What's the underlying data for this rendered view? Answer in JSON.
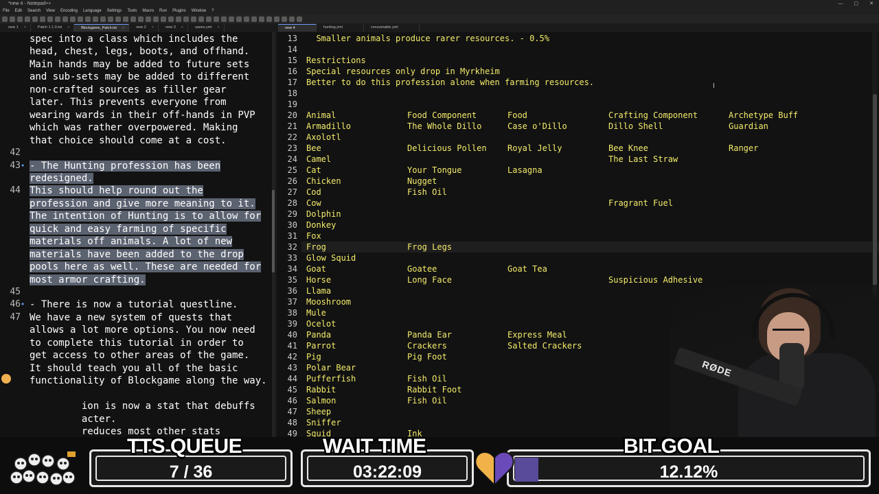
{
  "app": {
    "title": "*new 4 - Notepad++",
    "menu": [
      "File",
      "Edit",
      "Search",
      "View",
      "Encoding",
      "Language",
      "Settings",
      "Tools",
      "Macro",
      "Run",
      "Plugins",
      "Window",
      "?"
    ],
    "window_controls": [
      "—",
      "▢",
      "✕"
    ]
  },
  "left_tabs": [
    "new 1",
    "Patch 1.1.0.txt",
    "Blockgame_Patch.txt",
    "new 2",
    "new 3",
    "saves.yml"
  ],
  "right_tabs": [
    "new 4",
    "hunting.yml",
    "consumable.yml"
  ],
  "left_editor": {
    "lines": [
      {
        "num": "",
        "text": "spec into a class which includes the",
        "hl": false
      },
      {
        "num": "",
        "text": "head, chest, legs, boots, and offhand.",
        "hl": false
      },
      {
        "num": "",
        "text": "Main hands may be added to future sets",
        "hl": false
      },
      {
        "num": "",
        "text": "and sub-sets may be added to different",
        "hl": false
      },
      {
        "num": "",
        "text": "non-crafted sources as filler gear",
        "hl": false
      },
      {
        "num": "",
        "text": "later. This prevents everyone from",
        "hl": false
      },
      {
        "num": "",
        "text": "wearing wards in their off-hands in PVP",
        "hl": false
      },
      {
        "num": "",
        "text": "which was rather overpowered. Making",
        "hl": false
      },
      {
        "num": "",
        "text": "that choice should come at a cost.",
        "hl": false
      },
      {
        "num": "42",
        "text": "",
        "hl": false
      },
      {
        "num": "43",
        "text": "- The Hunting profession has been",
        "hl": true
      },
      {
        "num": "",
        "text": "redesigned.",
        "hl": true
      },
      {
        "num": "44",
        "text": "This should help round out the",
        "hl": true
      },
      {
        "num": "",
        "text": "profession and give more meaning to it.",
        "hl": true
      },
      {
        "num": "",
        "text": "The intention of Hunting is to allow for",
        "hl": true
      },
      {
        "num": "",
        "text": "quick and easy farming of specific",
        "hl": true
      },
      {
        "num": "",
        "text": "materials off animals. A lot of new",
        "hl": true
      },
      {
        "num": "",
        "text": "materials have been added to the drop",
        "hl": true
      },
      {
        "num": "",
        "text": "pools here as well. These are needed for",
        "hl": true
      },
      {
        "num": "",
        "text": "most armor crafting.",
        "hl": true
      },
      {
        "num": "45",
        "text": "",
        "hl": false
      },
      {
        "num": "46",
        "text": "- There is now a tutorial questline.",
        "hl": false
      },
      {
        "num": "47",
        "text": "We have a new system of quests that",
        "hl": false
      },
      {
        "num": "",
        "text": "allows a lot more options. You now need",
        "hl": false
      },
      {
        "num": "",
        "text": "to complete this tutorial in order to",
        "hl": false
      },
      {
        "num": "",
        "text": "get access to other areas of the game.",
        "hl": false
      },
      {
        "num": "",
        "text": "It should teach you all of the basic",
        "hl": false
      },
      {
        "num": "",
        "text": "functionality of Blockgame along the way.",
        "hl": false
      },
      {
        "num": "",
        "text": "",
        "hl": false
      },
      {
        "num": "",
        "text": "         ion is now a stat that debuffs",
        "hl": false
      },
      {
        "num": "",
        "text": "         acter.",
        "hl": false
      },
      {
        "num": "",
        "text": "         reduces most other stats",
        "hl": false
      }
    ]
  },
  "right_editor": {
    "rows": [
      {
        "num": "13",
        "cells": [
          "  Smaller animals produce rarer resources. - 0.5%",
          "",
          "",
          "",
          ""
        ]
      },
      {
        "num": "14",
        "cells": [
          "",
          "",
          "",
          "",
          ""
        ]
      },
      {
        "num": "15",
        "cells": [
          "Restrictions",
          "",
          "",
          "",
          ""
        ]
      },
      {
        "num": "16",
        "cells": [
          "Special resources only drop in Myrkheim",
          "",
          "",
          "",
          ""
        ]
      },
      {
        "num": "17",
        "cells": [
          "Better to do this profession alone when farming resources.",
          "",
          "",
          "",
          ""
        ]
      },
      {
        "num": "18",
        "cells": [
          "",
          "",
          "",
          "",
          ""
        ]
      },
      {
        "num": "19",
        "cells": [
          "",
          "",
          "",
          "",
          ""
        ]
      },
      {
        "num": "20",
        "cells": [
          "Animal",
          "Food Component",
          "Food",
          "Crafting Component",
          "Archetype Buff"
        ]
      },
      {
        "num": "21",
        "cells": [
          "Armadillo",
          "The Whole Dillo",
          "Case o'Dillo",
          "Dillo Shell",
          "Guardian"
        ]
      },
      {
        "num": "22",
        "cells": [
          "Axolotl",
          "",
          "",
          "",
          ""
        ]
      },
      {
        "num": "23",
        "cells": [
          "Bee",
          "Delicious Pollen",
          "Royal Jelly",
          "Bee Knee",
          "Ranger"
        ]
      },
      {
        "num": "24",
        "cells": [
          "Camel",
          "",
          "",
          "The Last Straw",
          ""
        ]
      },
      {
        "num": "25",
        "cells": [
          "Cat",
          "Your Tongue",
          "Lasagna",
          "",
          ""
        ]
      },
      {
        "num": "26",
        "cells": [
          "Chicken",
          "Nugget",
          "",
          "",
          ""
        ]
      },
      {
        "num": "27",
        "cells": [
          "Cod",
          "Fish Oil",
          "",
          "",
          ""
        ]
      },
      {
        "num": "28",
        "cells": [
          "Cow",
          "",
          "",
          "Fragrant Fuel",
          ""
        ]
      },
      {
        "num": "29",
        "cells": [
          "Dolphin",
          "",
          "",
          "",
          ""
        ]
      },
      {
        "num": "30",
        "cells": [
          "Donkey",
          "",
          "",
          "",
          ""
        ]
      },
      {
        "num": "31",
        "cells": [
          "Fox",
          "",
          "",
          "",
          ""
        ]
      },
      {
        "num": "32",
        "cells": [
          "Frog",
          "Frog Legs",
          "",
          "",
          ""
        ]
      },
      {
        "num": "33",
        "cells": [
          "Glow Squid",
          "",
          "",
          "",
          ""
        ]
      },
      {
        "num": "34",
        "cells": [
          "Goat",
          "Goatee",
          "Goat Tea",
          "",
          ""
        ]
      },
      {
        "num": "35",
        "cells": [
          "Horse",
          "Long Face",
          "",
          "Suspicious Adhesive",
          ""
        ]
      },
      {
        "num": "36",
        "cells": [
          "Llama",
          "",
          "",
          "",
          ""
        ]
      },
      {
        "num": "37",
        "cells": [
          "Mooshroom",
          "",
          "",
          "",
          ""
        ]
      },
      {
        "num": "38",
        "cells": [
          "Mule",
          "",
          "",
          "",
          ""
        ]
      },
      {
        "num": "39",
        "cells": [
          "Ocelot",
          "",
          "",
          "",
          ""
        ]
      },
      {
        "num": "40",
        "cells": [
          "Panda",
          "Panda Ear",
          "Express Meal",
          "",
          ""
        ]
      },
      {
        "num": "41",
        "cells": [
          "Parrot",
          "Crackers",
          "Salted Crackers",
          "",
          ""
        ]
      },
      {
        "num": "42",
        "cells": [
          "Pig",
          "Pig Foot",
          "",
          "",
          ""
        ]
      },
      {
        "num": "43",
        "cells": [
          "Polar Bear",
          "",
          "",
          "",
          ""
        ]
      },
      {
        "num": "44",
        "cells": [
          "Pufferfish",
          "Fish Oil",
          "",
          "",
          ""
        ]
      },
      {
        "num": "45",
        "cells": [
          "Rabbit",
          "Rabbit Foot",
          "",
          "",
          ""
        ]
      },
      {
        "num": "46",
        "cells": [
          "Salmon",
          "Fish Oil",
          "",
          "",
          ""
        ]
      },
      {
        "num": "47",
        "cells": [
          "Sheep",
          "",
          "",
          "",
          ""
        ]
      },
      {
        "num": "48",
        "cells": [
          "Sniffer",
          "",
          "",
          "",
          ""
        ]
      },
      {
        "num": "49",
        "cells": [
          "Squid",
          "Ink",
          "",
          "",
          ""
        ]
      }
    ],
    "current_line": "32"
  },
  "webcam": {
    "mic_brand": "RØDE"
  },
  "overlay": {
    "tts_title": "TTS QUEUE",
    "tts_value": "7 / 36",
    "wait_title": "WAIT TIME",
    "wait_value": "03:22:09",
    "bit_title": "BIT GOAL",
    "bit_value": "12.12%",
    "bit_progress": 0.1212
  }
}
